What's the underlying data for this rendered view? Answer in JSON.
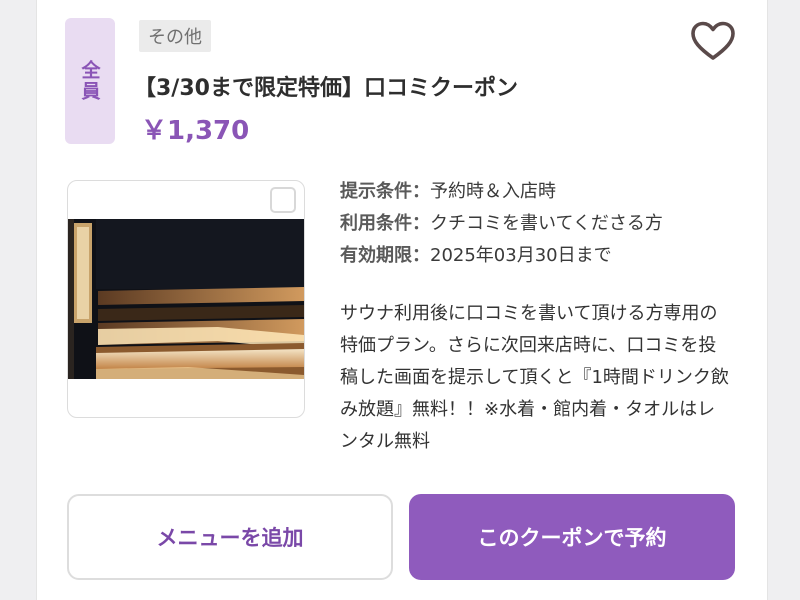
{
  "coupon": {
    "target_label": "全員",
    "category": "その他",
    "title": "【3/30まで限定特価】口コミクーポン",
    "price": "￥1,370",
    "conditions": [
      {
        "label": "提示条件：",
        "value": "予約時＆入店時"
      },
      {
        "label": "利用条件：",
        "value": "クチコミを書いてくださる方"
      },
      {
        "label": "有効期限：",
        "value": "2025年03月30日まで"
      }
    ],
    "description": "サウナ利用後に口コミを書いて頂ける方専用の特価プラン。さらに次回来店時に、口コミを投稿した画面を提示して頂くと『1時間ドリンク飲み放題』無料！！※水着・館内着・タオルはレンタル無料"
  },
  "buttons": {
    "add_menu": "メニューを追加",
    "reserve": "このクーポンで予約"
  },
  "icons": {
    "favorite": "heart-outline-icon",
    "photo_select": "checkbox-icon"
  },
  "colors": {
    "accent": "#8f5bbd",
    "badge_bg": "#e9dcf2"
  }
}
